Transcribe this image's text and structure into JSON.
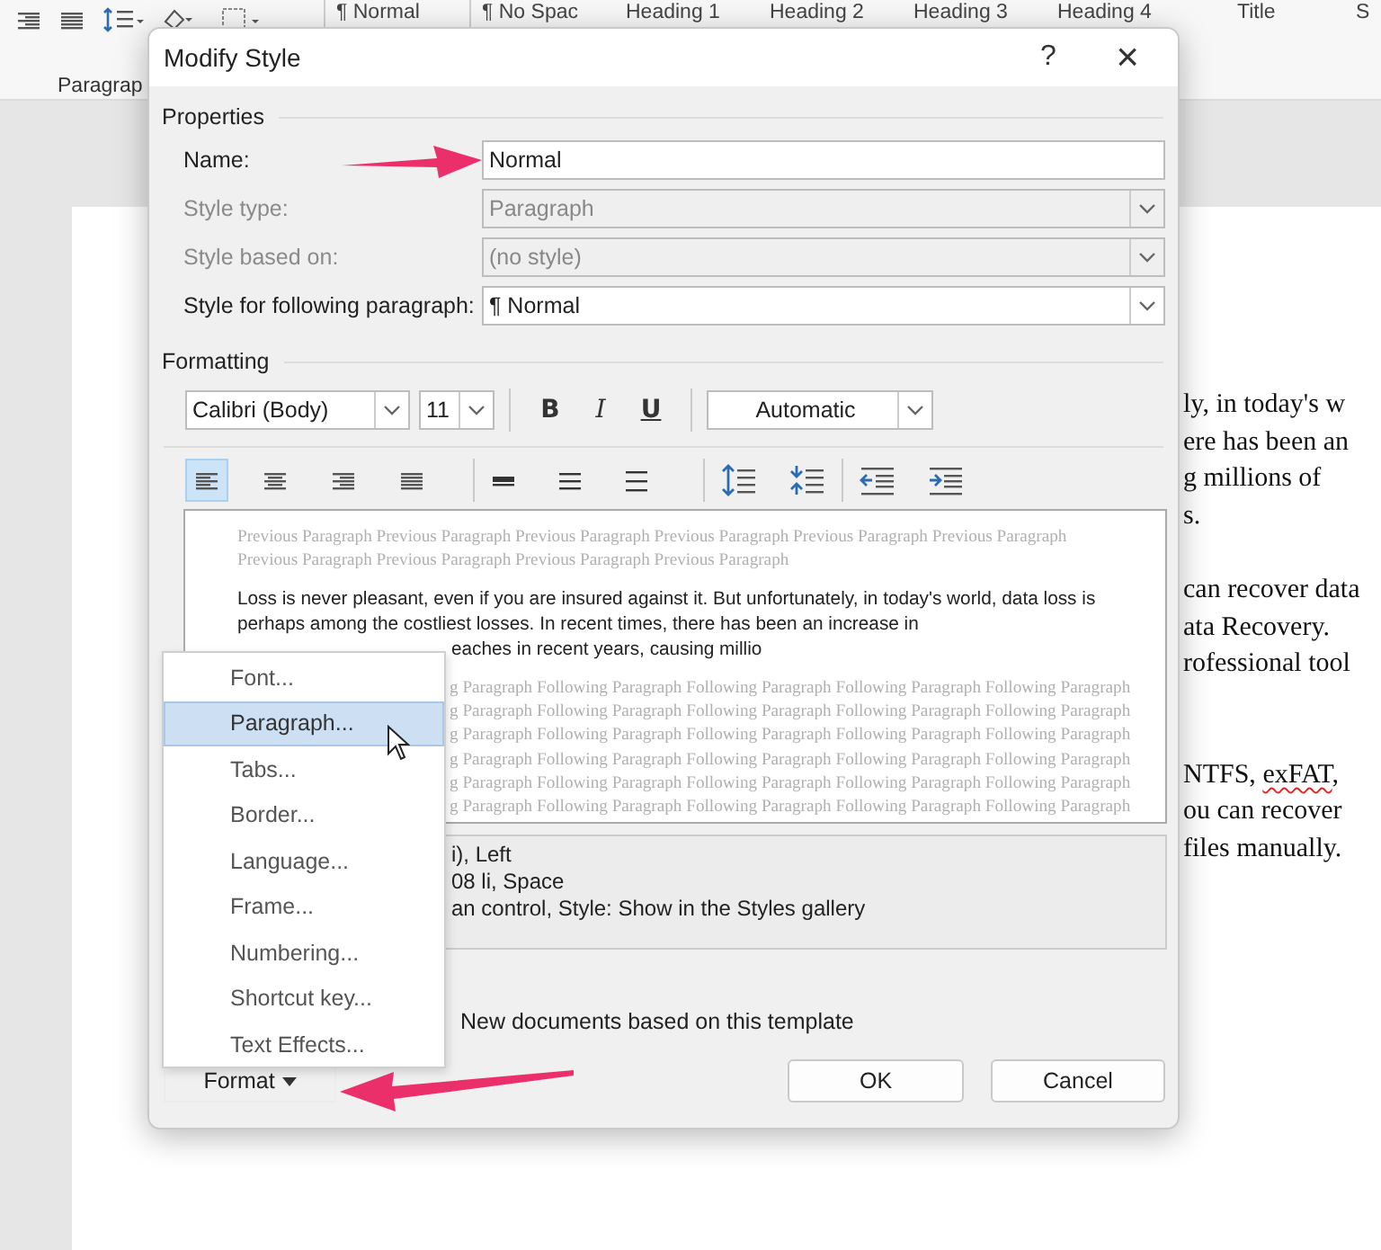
{
  "ribbon": {
    "group_label": "Paragrap",
    "styles": [
      {
        "label": "¶ Normal"
      },
      {
        "label": "¶ No Spac"
      },
      {
        "label": "Heading 1"
      },
      {
        "label": "Heading 2"
      },
      {
        "label": "Heading 3"
      },
      {
        "label": "Heading 4"
      },
      {
        "label": "Title"
      },
      {
        "label": "S"
      }
    ]
  },
  "document": {
    "paragraphs": [
      {
        "lines": [
          [
            {
              "text": "ly, in today's w",
              "misspelled": false
            }
          ],
          [
            {
              "text": "ere has been an",
              "misspelled": false
            }
          ],
          [
            {
              "text": "g millions of",
              "misspelled": false
            }
          ],
          [
            {
              "text": "s.",
              "misspelled": false
            }
          ]
        ]
      },
      {
        "lines": [
          [
            {
              "text": "can recover data",
              "misspelled": false
            }
          ],
          [
            {
              "text": "ata Recovery.",
              "misspelled": false
            }
          ],
          [
            {
              "text": "rofessional tool",
              "misspelled": false
            }
          ]
        ]
      },
      {
        "lines": [
          [
            {
              "text": "NTFS, ",
              "misspelled": false
            },
            {
              "text": "exFAT",
              "misspelled": true
            },
            {
              "text": ",",
              "misspelled": false
            }
          ],
          [
            {
              "text": "ou can recover",
              "misspelled": false
            }
          ],
          [
            {
              "text": "files manually.",
              "misspelled": false
            }
          ]
        ]
      }
    ]
  },
  "dialog": {
    "title": "Modify Style",
    "help": "?",
    "close": "×",
    "properties": {
      "heading": "Properties",
      "fields": [
        {
          "label": "Name:",
          "value": "Normal",
          "kind": "text",
          "disabled": false
        },
        {
          "label": "Style type:",
          "value": "Paragraph",
          "kind": "dropdown",
          "disabled": true
        },
        {
          "label": "Style based on:",
          "value": "(no style)",
          "kind": "dropdown",
          "disabled": true
        },
        {
          "label": "Style for following paragraph:",
          "value": "¶ Normal",
          "kind": "dropdown",
          "disabled": false
        }
      ]
    },
    "formatting": {
      "heading": "Formatting",
      "font": "Calibri (Body)",
      "size": "11",
      "color_setting": "Automatic",
      "styles": [
        {
          "label": "B",
          "kind": "bold"
        },
        {
          "label": "I",
          "kind": "italic"
        },
        {
          "label": "U",
          "kind": "underline"
        }
      ],
      "alignment": [
        {
          "kind": "left",
          "selected": true
        },
        {
          "kind": "center",
          "selected": false
        },
        {
          "kind": "right",
          "selected": false
        },
        {
          "kind": "justify",
          "selected": false
        }
      ]
    },
    "preview": {
      "previous": "Previous Paragraph Previous Paragraph Previous Paragraph Previous Paragraph Previous Paragraph Previous Paragraph Previous Paragraph Previous Paragraph Previous Paragraph Previous Paragraph",
      "sample": "Loss is never pleasant, even if you are insured against it. But unfortunately, in today's world, data loss is perhaps among the costliest losses. In recent times, there has been an increase in",
      "sample_tail": "eaches in recent years, causing millio",
      "following": [
        "g Paragraph Following Paragraph Following Paragraph Following Paragraph Following Paragraph",
        "g Paragraph Following Paragraph Following Paragraph Following Paragraph Following Paragraph",
        "g Paragraph Following Paragraph Following Paragraph Following Paragraph Following Paragraph",
        "g Paragraph Following Paragraph Following Paragraph Following Paragraph Following Paragraph",
        "g Paragraph Following Paragraph Following Paragraph Following Paragraph Following Paragraph",
        "g Paragraph Following Paragraph Following Paragraph Following Paragraph Following Paragraph"
      ]
    },
    "description": [
      "i), Left",
      "08 li, Space",
      "an control, Style: Show in the Styles gallery"
    ],
    "template_option": "New documents based on this template",
    "format_button": "Format",
    "buttons": [
      "OK",
      "Cancel"
    ]
  },
  "format_menu": {
    "items": [
      {
        "label": "Font...",
        "selected": false
      },
      {
        "label": "Paragraph...",
        "selected": true
      },
      {
        "label": "Tabs...",
        "selected": false
      },
      {
        "label": "Border...",
        "selected": false
      },
      {
        "label": "Language...",
        "selected": false
      },
      {
        "label": "Frame...",
        "selected": false
      },
      {
        "label": "Numbering...",
        "selected": false
      },
      {
        "label": "Shortcut key...",
        "selected": false
      },
      {
        "label": "Text Effects...",
        "selected": false
      }
    ]
  }
}
